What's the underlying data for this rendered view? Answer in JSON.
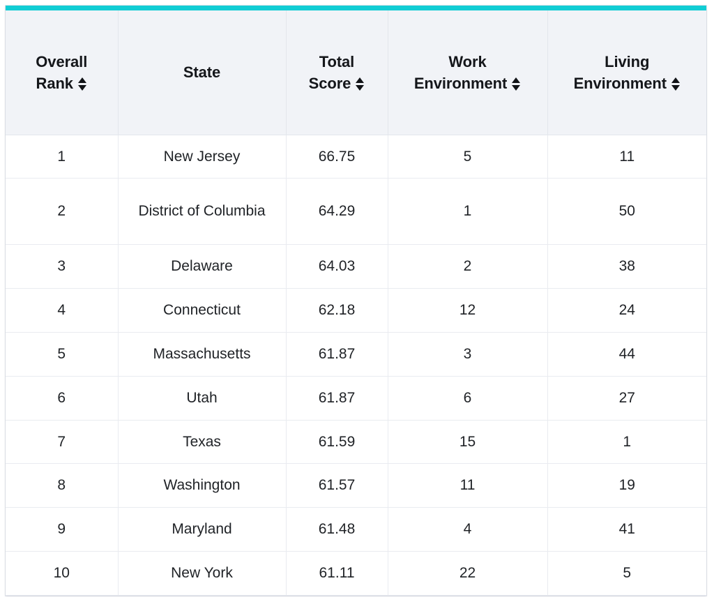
{
  "accent_color": "#11cdd4",
  "table": {
    "columns": [
      {
        "id": "overall-rank",
        "line1": "Overall",
        "line2": "Rank",
        "sortable": true,
        "sort_icon": "sort-updown-icon"
      },
      {
        "id": "state",
        "line1": "State",
        "line2": "",
        "sortable": false,
        "sort_icon": ""
      },
      {
        "id": "total-score",
        "line1": "Total",
        "line2": "Score",
        "sortable": true,
        "sort_icon": "sort-updown-icon"
      },
      {
        "id": "work-environment",
        "line1": "Work",
        "line2": "Environment",
        "sortable": true,
        "sort_icon": "sort-updown-icon"
      },
      {
        "id": "living-environment",
        "line1": "Living",
        "line2": "Environment",
        "sortable": true,
        "sort_icon": "sort-updown-icon"
      }
    ],
    "rows": [
      {
        "rank": "1",
        "state": "New Jersey",
        "total_score": "66.75",
        "work_environment": "5",
        "living_environment": "11"
      },
      {
        "rank": "2",
        "state": "District of Columbia",
        "total_score": "64.29",
        "work_environment": "1",
        "living_environment": "50"
      },
      {
        "rank": "3",
        "state": "Delaware",
        "total_score": "64.03",
        "work_environment": "2",
        "living_environment": "38"
      },
      {
        "rank": "4",
        "state": "Connecticut",
        "total_score": "62.18",
        "work_environment": "12",
        "living_environment": "24"
      },
      {
        "rank": "5",
        "state": "Massachusetts",
        "total_score": "61.87",
        "work_environment": "3",
        "living_environment": "44"
      },
      {
        "rank": "6",
        "state": "Utah",
        "total_score": "61.87",
        "work_environment": "6",
        "living_environment": "27"
      },
      {
        "rank": "7",
        "state": "Texas",
        "total_score": "61.59",
        "work_environment": "15",
        "living_environment": "1"
      },
      {
        "rank": "8",
        "state": "Washington",
        "total_score": "61.57",
        "work_environment": "11",
        "living_environment": "19"
      },
      {
        "rank": "9",
        "state": "Maryland",
        "total_score": "61.48",
        "work_environment": "4",
        "living_environment": "41"
      },
      {
        "rank": "10",
        "state": "New York",
        "total_score": "61.11",
        "work_environment": "22",
        "living_environment": "5"
      }
    ]
  }
}
